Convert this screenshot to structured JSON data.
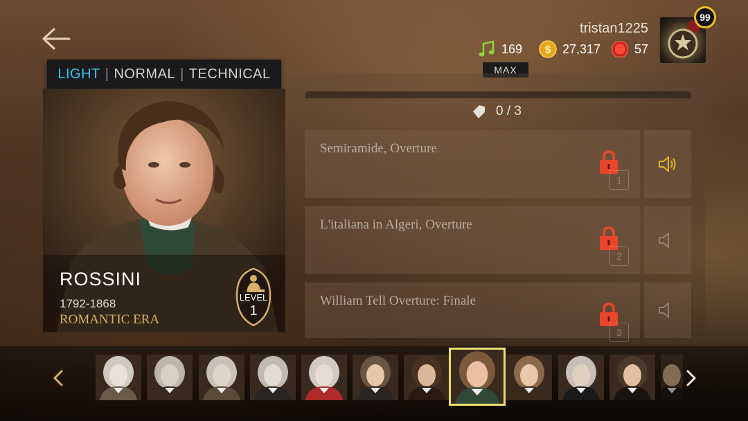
{
  "user": {
    "name": "tristan1225",
    "level": "99"
  },
  "resources": {
    "notes": "169",
    "notes_tag": "MAX",
    "coins": "27,317",
    "gems": "57"
  },
  "difficulty_tabs": {
    "light": "LIGHT",
    "normal": "NORMAL",
    "technical": "TECHNICAL",
    "separator": "|"
  },
  "composer": {
    "name": "ROSSINI",
    "years": "1792-1868",
    "era": "ROMANTIC ERA",
    "level_label": "LEVEL",
    "level_value": "1"
  },
  "progress": "0 / 3",
  "songs": [
    {
      "title": "Semiramide, Overture",
      "number": "1",
      "locked": true,
      "speaker_active": true
    },
    {
      "title": "L'italiana in Algeri, Overture",
      "number": "2",
      "locked": true,
      "speaker_active": false
    },
    {
      "title": "William Tell Overture: Finale",
      "number": "3",
      "locked": true,
      "speaker_active": false
    }
  ],
  "colors": {
    "accent_blue": "#33c6f0",
    "era_gold": "#d9b068",
    "lock_red": "#e8452a",
    "speaker_active": "#e6b422",
    "selected_border": "#f0e070"
  },
  "composer_thumbnails": [
    {
      "name": "composer-thumb-1",
      "selected": false
    },
    {
      "name": "composer-thumb-2",
      "selected": false
    },
    {
      "name": "composer-thumb-3",
      "selected": false
    },
    {
      "name": "composer-thumb-4",
      "selected": false
    },
    {
      "name": "composer-thumb-5",
      "selected": false
    },
    {
      "name": "composer-thumb-6",
      "selected": false
    },
    {
      "name": "composer-thumb-7",
      "selected": false
    },
    {
      "name": "composer-thumb-rossini",
      "selected": true
    },
    {
      "name": "composer-thumb-9",
      "selected": false
    },
    {
      "name": "composer-thumb-10",
      "selected": false
    },
    {
      "name": "composer-thumb-11",
      "selected": false
    },
    {
      "name": "composer-thumb-12",
      "selected": false
    }
  ]
}
